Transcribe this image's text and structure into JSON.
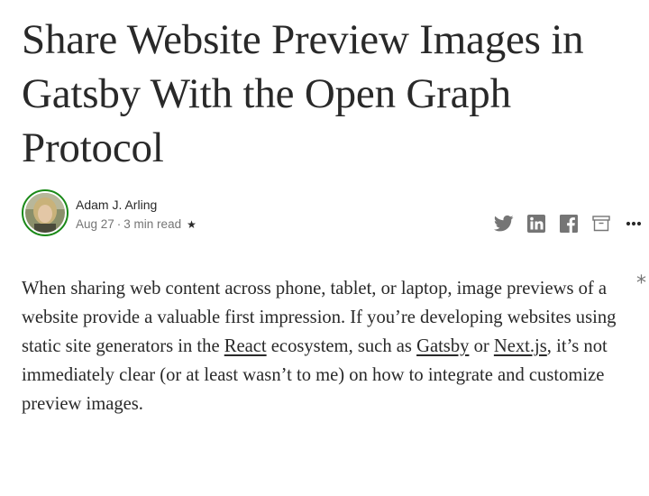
{
  "article": {
    "title": "Share Website Preview Images in Gatsby With the Open Graph Protocol",
    "author": "Adam J. Arling",
    "date": "Aug 27",
    "separator": "·",
    "read_time": "3 min read",
    "member_star": "★"
  },
  "actions": [
    {
      "name": "twitter-icon",
      "label": "twitter"
    },
    {
      "name": "linkedin-icon",
      "label": "linkedin"
    },
    {
      "name": "facebook-icon",
      "label": "facebook"
    },
    {
      "name": "bookmark-icon",
      "label": "save"
    },
    {
      "name": "more-icon",
      "label": "more"
    }
  ],
  "side_mark": "*",
  "paragraph": {
    "part1": "When sharing web content across phone, tablet, or laptop, image previews of a website provide a valuable first impression. If you’re developing websites using static site generators in the ",
    "link1": "React",
    "part2": " ecosystem, such as ",
    "link2": "Gatsby",
    "part3": " or ",
    "link3": "Next.js",
    "part4": ", it’s not immediately clear (or at least wasn’t to me) on how to integrate and customize preview images."
  },
  "colors": {
    "text": "#292929",
    "muted": "#757575",
    "avatar_ring": "#1a8917",
    "icon": "#757575"
  }
}
